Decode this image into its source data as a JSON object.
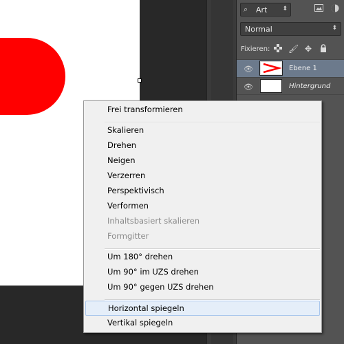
{
  "layers_panel": {
    "kind_filter": {
      "icon": "search-icon",
      "label": "Art"
    },
    "blend_mode": "Normal",
    "lock_label": "Fixieren:",
    "layers": [
      {
        "name": "Ebene 1",
        "selected": true,
        "visible": true
      },
      {
        "name": "Hintergrund",
        "selected": false,
        "visible": true
      }
    ]
  },
  "context_menu": {
    "groups": [
      [
        {
          "label": "Frei transformieren",
          "enabled": true
        }
      ],
      [
        {
          "label": "Skalieren",
          "enabled": true
        },
        {
          "label": "Drehen",
          "enabled": true
        },
        {
          "label": "Neigen",
          "enabled": true
        },
        {
          "label": "Verzerren",
          "enabled": true
        },
        {
          "label": "Perspektivisch",
          "enabled": true
        },
        {
          "label": "Verformen",
          "enabled": true
        },
        {
          "label": "Inhaltsbasiert skalieren",
          "enabled": false
        },
        {
          "label": "Formgitter",
          "enabled": false
        }
      ],
      [
        {
          "label": "Um 180° drehen",
          "enabled": true
        },
        {
          "label": "Um 90° im UZS drehen",
          "enabled": true
        },
        {
          "label": "Um 90° gegen UZS drehen",
          "enabled": true
        }
      ],
      [
        {
          "label": "Horizontal spiegeln",
          "enabled": true,
          "hovered": true
        },
        {
          "label": "Vertikal spiegeln",
          "enabled": true
        }
      ]
    ]
  },
  "colors": {
    "canvas_stroke": "#ff0000",
    "selected_layer": "#6c7a8c",
    "menu_hover": "#e5eef9"
  }
}
